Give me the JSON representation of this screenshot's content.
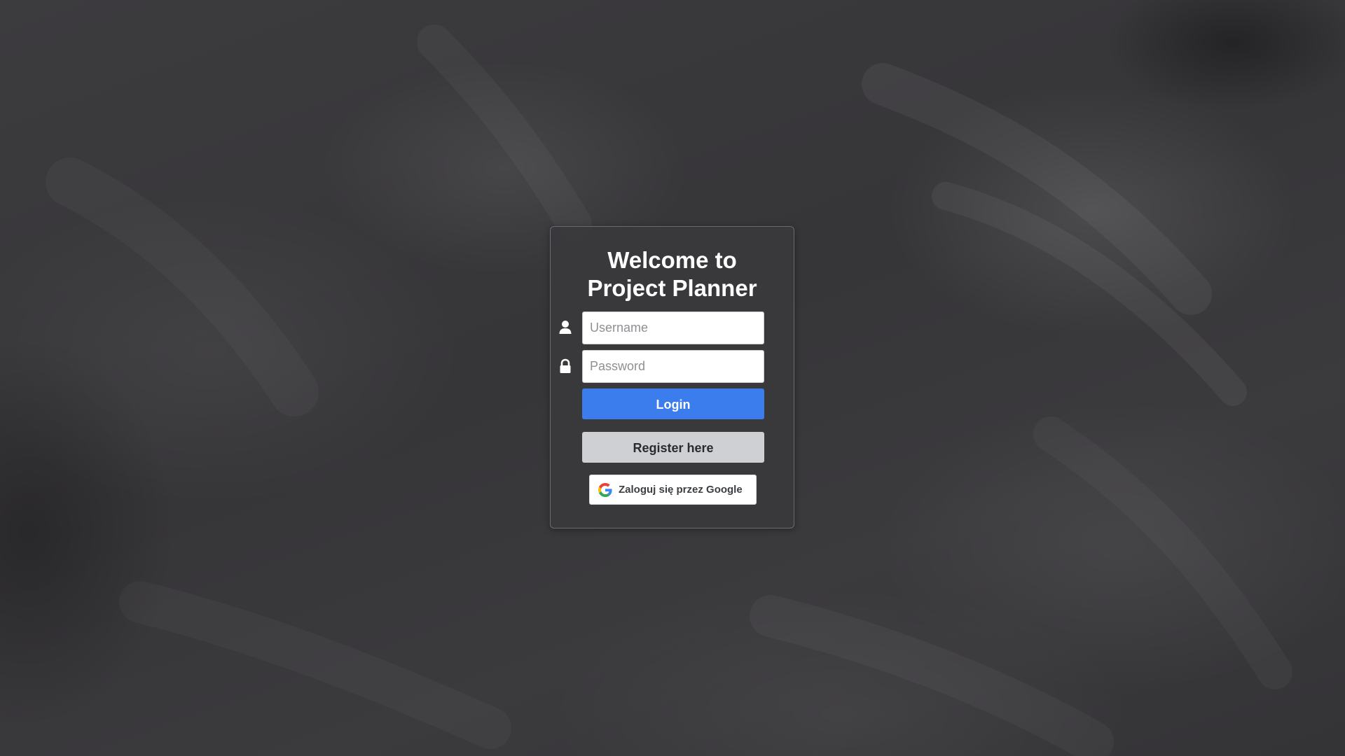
{
  "page": {
    "title_line1": "Welcome to",
    "title_line2": "Project Planner"
  },
  "form": {
    "username": {
      "placeholder": "Username",
      "value": "",
      "icon": "user-icon"
    },
    "password": {
      "placeholder": "Password",
      "value": "",
      "icon": "lock-icon"
    },
    "login_label": "Login",
    "register_label": "Register here",
    "google_label": "Zaloguj się przez Google",
    "google_icon": "google-g-icon"
  },
  "colors": {
    "background": "#3a393b",
    "card": "#3a383c",
    "login_button": "#3b7ded",
    "register_button": "#cfd0d4",
    "google_button": "#ffffff"
  }
}
